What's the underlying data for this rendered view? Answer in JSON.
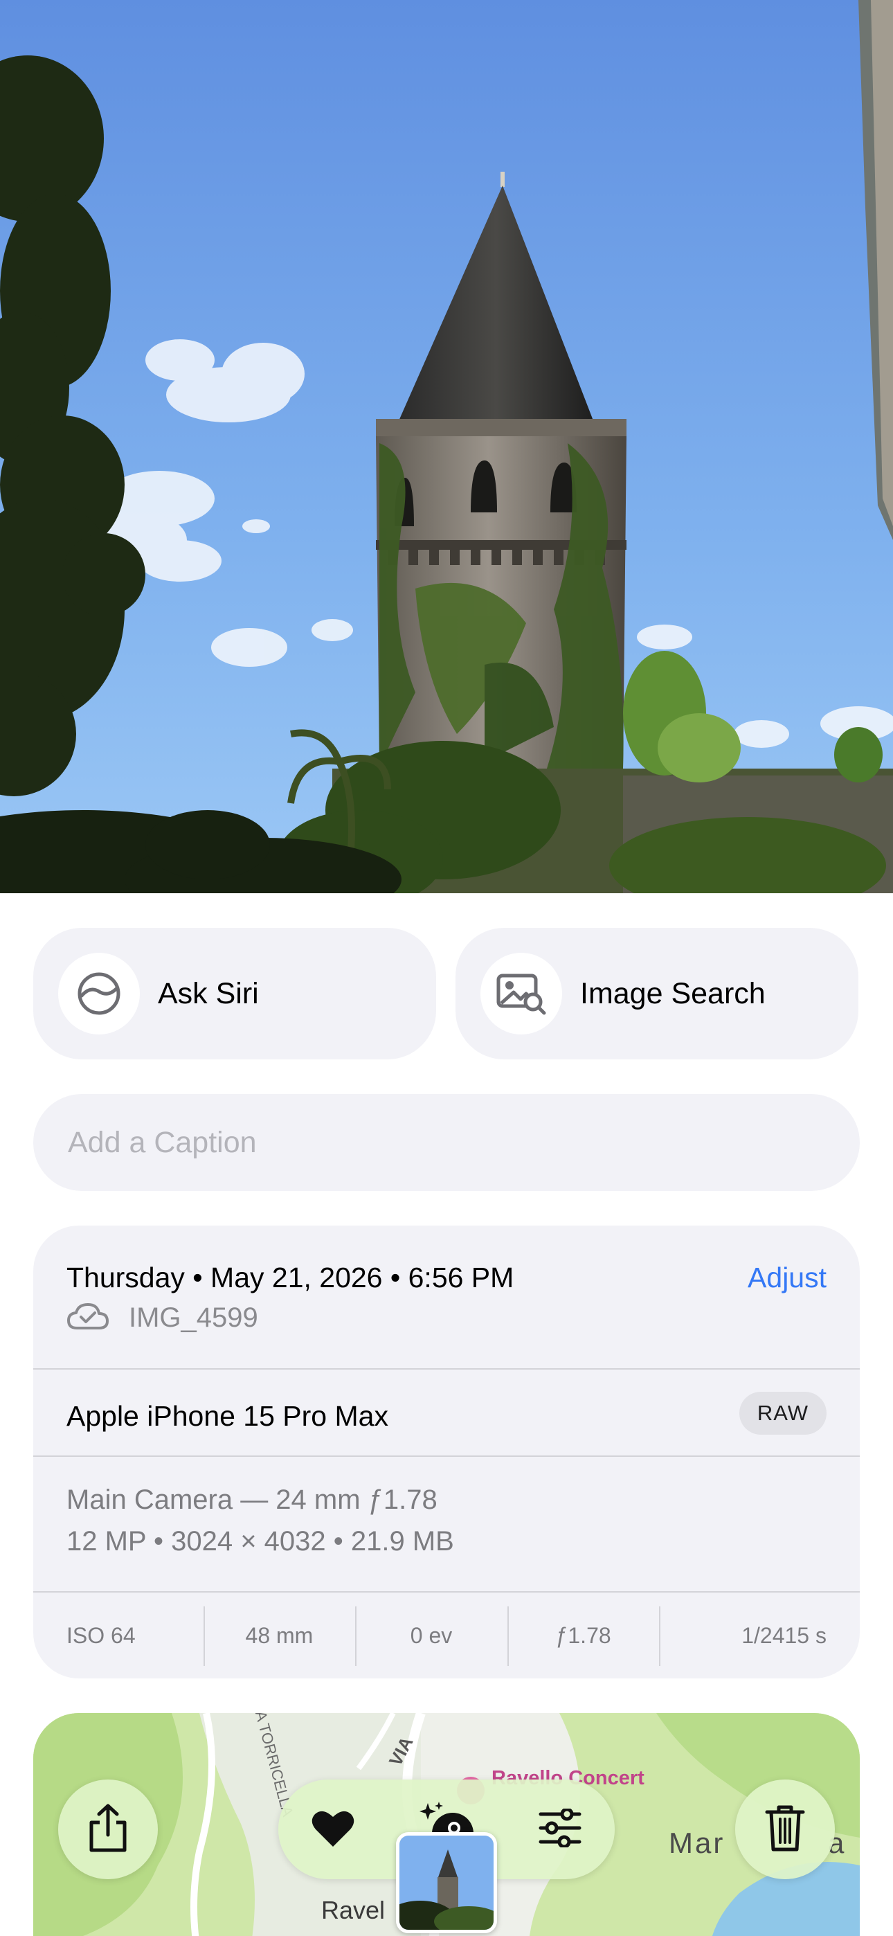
{
  "actions": {
    "ask_siri": "Ask Siri",
    "image_search": "Image Search"
  },
  "caption": {
    "placeholder": "Add a Caption",
    "value": ""
  },
  "info": {
    "date_line": "Thursday • May 21, 2026 • 6:56 PM",
    "adjust_label": "Adjust",
    "file_name": "IMG_4599",
    "cloud_status_icon": "icloud-checkmark-icon",
    "device": "Apple iPhone 15 Pro Max",
    "format_badge": "RAW",
    "lens": "Main Camera — 24 mm ƒ1.78",
    "specs": "12 MP • 3024 × 4032 • 21.9 MB",
    "exif": {
      "iso": "ISO 64",
      "focal": "48 mm",
      "ev": "0 ev",
      "aperture": "ƒ1.78",
      "shutter": "1/2415 s"
    }
  },
  "map": {
    "labels": {
      "road_1": "A TORRICELLA",
      "road_2": "VIA",
      "poi": "Ravello Concert",
      "town": "Ravel",
      "region": "Mar",
      "region_tail": "a"
    }
  },
  "toolbar": {
    "share_icon": "share-icon",
    "favorite_icon": "heart-icon",
    "visual_lookup_icon": "visual-lookup-icon",
    "edit_icon": "sliders-icon",
    "delete_icon": "trash-icon"
  },
  "colors": {
    "accent": "#3478f6",
    "card_bg": "#f2f2f7",
    "toolbar_bg": "#e0f4c8",
    "sky_top": "#5f8fe0",
    "sky_bottom": "#9cc8f5"
  }
}
